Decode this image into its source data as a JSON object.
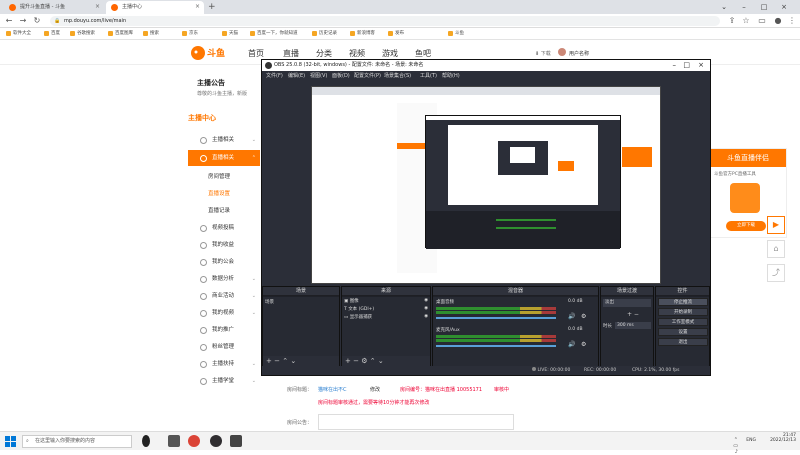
{
  "browser": {
    "tabs": [
      {
        "title": "提升斗鱼直播 - 斗鱼",
        "active": false
      },
      {
        "title": "主播中心",
        "active": true
      }
    ],
    "url": "mp.douyu.com/live/main",
    "bookmarks": [
      "软件大全",
      "百度",
      "谷歌搜索",
      "百度图库",
      "搜索",
      "京东",
      "天猫",
      "百度一下，你就知道",
      "历史记录",
      "新浪博客",
      "发布",
      "斗鱼"
    ]
  },
  "site": {
    "nav": [
      "首页",
      "直播",
      "分类",
      "视频",
      "游戏",
      "鱼吧"
    ],
    "download_label": "下载",
    "user_label": "用户名称",
    "notice_title": "主播公告",
    "notice_text": "尊敬的斗鱼主播，新版",
    "section_title": "主播中心",
    "sidebar": [
      {
        "label": "主播相关",
        "highlight": false
      },
      {
        "label": "直播相关",
        "highlight": true
      }
    ],
    "sidebar_subs": [
      {
        "label": "房间管理",
        "highlight": false
      },
      {
        "label": "直播设置",
        "highlight": true
      },
      {
        "label": "直播记录",
        "highlight": false
      }
    ],
    "sidebar_more": [
      "视频投稿",
      "我的收益",
      "我的公会",
      "数据分析",
      "商业活动",
      "我的视频",
      "我的推广",
      "粉丝管理",
      "主播扶持",
      "主播学堂"
    ],
    "form": {
      "room_title_label": "房间标题：",
      "room_title_value": "猫咪在出不C",
      "modify_label": "修改",
      "room_id_label": "房间编号：猫咪在出直播 10055171",
      "room_id_note": "审核中",
      "notice_red": "房间标题审核通过，需要等待10分钟才能再次修改",
      "announcement_label": "房间公告："
    },
    "ad": {
      "title": "斗鱼直播伴侣",
      "subtitle": "斗鱼官方PC直播工具",
      "button": "立即下载"
    }
  },
  "obs": {
    "title": "OBS 25.0.8 (32-bit, windows) - 配置文件: 未命名 - 场景: 未命名",
    "menu": [
      "文件(F)",
      "编辑(E)",
      "视图(V)",
      "面板(D)",
      "配置文件(P)",
      "场景集合(S)",
      "工具(T)",
      "帮助(H)"
    ],
    "docks": {
      "scenes": {
        "title": "场景",
        "items": [
          "场景"
        ]
      },
      "sources": {
        "title": "来源",
        "items": [
          "图像",
          "文本 (GDI+)",
          "显示器捕获"
        ]
      },
      "mixer": {
        "title": "混音器",
        "channels": [
          {
            "name": "桌面音频",
            "db": "0.0 dB"
          },
          {
            "name": "麦克风/Aux",
            "db": "0.0 dB"
          }
        ]
      },
      "transitions": {
        "title": "场景过渡",
        "type": "淡出",
        "duration_label": "时长",
        "duration": "300 ms"
      },
      "controls": {
        "title": "控件",
        "buttons": [
          "停止推流",
          "开始录制",
          "工作室模式",
          "设置",
          "退出"
        ]
      }
    },
    "status": {
      "live": "LIVE: 00:00:00",
      "rec": "REC: 00:00:00",
      "cpu": "CPU: 2.1%, 30.00 fps"
    }
  },
  "taskbar": {
    "search_placeholder": "在这里输入你要搜索的内容",
    "lang": "ENG",
    "time": "21:47",
    "date": "2022/12/13"
  }
}
